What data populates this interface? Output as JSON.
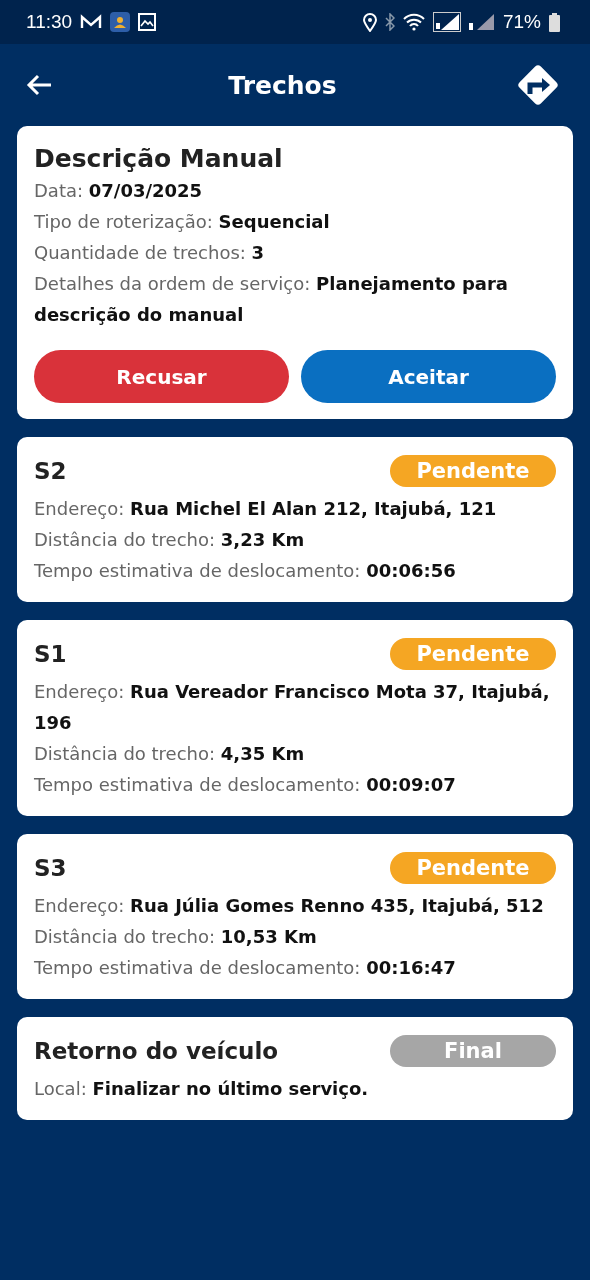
{
  "status_bar": {
    "time": "11:30",
    "battery": "71%"
  },
  "header": {
    "title": "Trechos"
  },
  "summary": {
    "title": "Descrição Manual",
    "details": [
      "Data: **07/03/2025**",
      "Tipo de roterização: **Sequencial**",
      "Quantidade de trechos: **3**",
      "Detalhes da ordem de serviço: **Planejamento para descrição do manual**"
    ],
    "buttons": [
      {
        "label": "Recusar",
        "kind": "reject"
      },
      {
        "label": "Aceitar",
        "kind": "accept"
      }
    ]
  },
  "stretches": [
    {
      "name": "S2",
      "status": {
        "label": "Pendente",
        "color": "#f5a623"
      },
      "details": [
        "Endereço: **Rua Michel El Alan 212, Itajubá, 121**",
        "Distância do trecho: **3,23 Km**",
        "Tempo estimativa de deslocamento: **00:06:56**"
      ]
    },
    {
      "name": "S1",
      "status": {
        "label": "Pendente",
        "color": "#f5a623"
      },
      "details": [
        "Endereço: **Rua Vereador Francisco Mota 37, Itajubá, 196**",
        "Distância do trecho: **4,35 Km**",
        "Tempo estimativa de deslocamento: **00:09:07**"
      ]
    },
    {
      "name": "S3",
      "status": {
        "label": "Pendente",
        "color": "#f5a623"
      },
      "details": [
        "Endereço: **Rua Júlia Gomes Renno 435, Itajubá, 512**",
        "Distância do trecho: **10,53 Km**",
        "Tempo estimativa de deslocamento: **00:16:47**"
      ]
    },
    {
      "name": "Retorno do veículo",
      "status": {
        "label": "Final",
        "color": "#a6a6a6"
      },
      "details": [
        "Local: **Finalizar no último serviço.**"
      ]
    }
  ]
}
